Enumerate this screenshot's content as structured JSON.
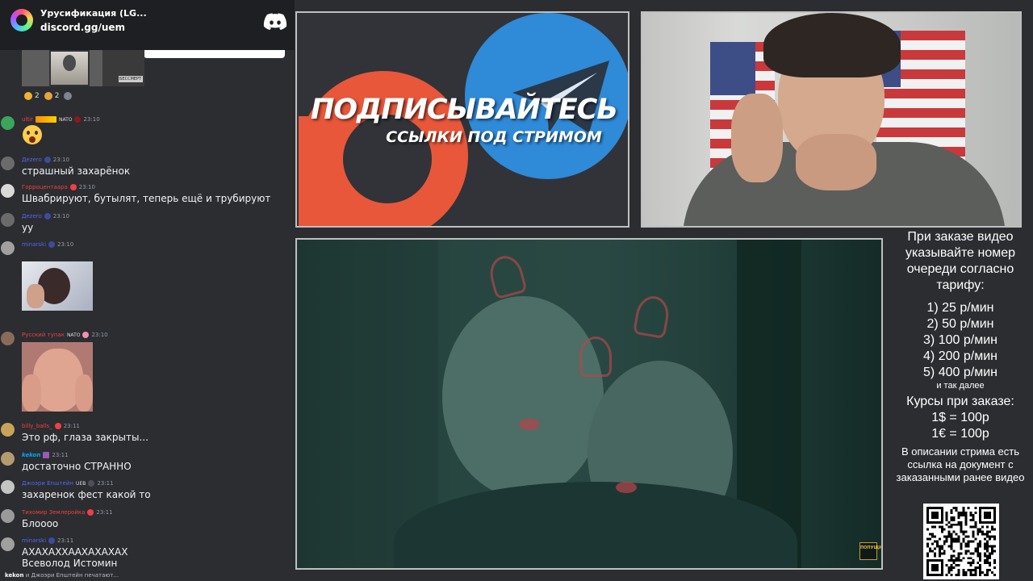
{
  "discord": {
    "server_name": "Урусификация (LG...",
    "invite": "discord.gg/uem"
  },
  "top_image": {
    "plaque_text": "БЕССМЕРТ"
  },
  "reactions": [
    {
      "count": "2",
      "color": "#f0b232"
    },
    {
      "count": "2",
      "color": "#e8a33a"
    }
  ],
  "messages": [
    {
      "author": "ultir",
      "author_color": "#f23f43",
      "tag": "NATO",
      "time": "23:10",
      "text": ""
    },
    {
      "author": "Дezero",
      "author_color": "#5865f2",
      "tag": "",
      "time": "23:10",
      "text": "страшный захарёнок"
    },
    {
      "author": "Горроцентаара",
      "author_color": "#f23f43",
      "tag": "",
      "time": "23:10",
      "text": "Швабрируют, бутылят, теперь ещё и трубируют"
    },
    {
      "author": "Дezero",
      "author_color": "#5865f2",
      "tag": "",
      "time": "23:10",
      "text": "уу"
    },
    {
      "author": "minarski",
      "author_color": "#5865f2",
      "tag": "",
      "time": "23:10",
      "text": ""
    },
    {
      "author": "Русский тупак",
      "author_color": "#f23f43",
      "tag": "NATO",
      "time": "23:10",
      "text": ""
    },
    {
      "author": "billy_balls_",
      "author_color": "#f23f43",
      "tag": "",
      "time": "23:11",
      "text": "Это рф, глаза закрыты..."
    },
    {
      "author": "kekon",
      "author_color": "#00a8fc",
      "tag": "",
      "time": "23:11",
      "text": "достаточно СТРАННО"
    },
    {
      "author": "Джоэри Епштейн",
      "author_color": "#5865f2",
      "tag": "UEB",
      "time": "23:11",
      "text": "захаренок фест какой то"
    },
    {
      "author": "Тихомир Землеройка",
      "author_color": "#f23f43",
      "tag": "",
      "time": "23:11",
      "text": "Блоооо"
    },
    {
      "author": "minarski",
      "author_color": "#5865f2",
      "tag": "",
      "time": "23:11",
      "text": "АХАХАХХААХАХАХАХ"
    }
  ],
  "last_message_line2": "Всеволод Истомин",
  "typing": {
    "names": "kekon",
    "rest": " и Джоэри Епштейн печатают..."
  },
  "promo": {
    "headline": "ПОДПИСЫВАЙТЕСЬ",
    "subline": "ССЫЛКИ ПОД СТРИМОМ",
    "patreon_color": "#e8573a",
    "telegram_color": "#2f8ad8"
  },
  "video": {
    "watermark": "ПОПУЩИШЬ"
  },
  "pricing": {
    "title": "При заказе видео указывайте номер очереди согласно тарифу:",
    "tiers": [
      "1) 25 р/мин",
      "2) 50 р/мин",
      "3) 100 р/мин",
      "4) 200 р/мин",
      "5) 400 р/мин"
    ],
    "and_so_on": "и так далее",
    "rates_title": "Курсы при заказе:",
    "rates": [
      "1$ = 100р",
      "1€ = 100р"
    ],
    "note": "В описании стрима есть ссылка на документ с заказанными ранее видео"
  }
}
